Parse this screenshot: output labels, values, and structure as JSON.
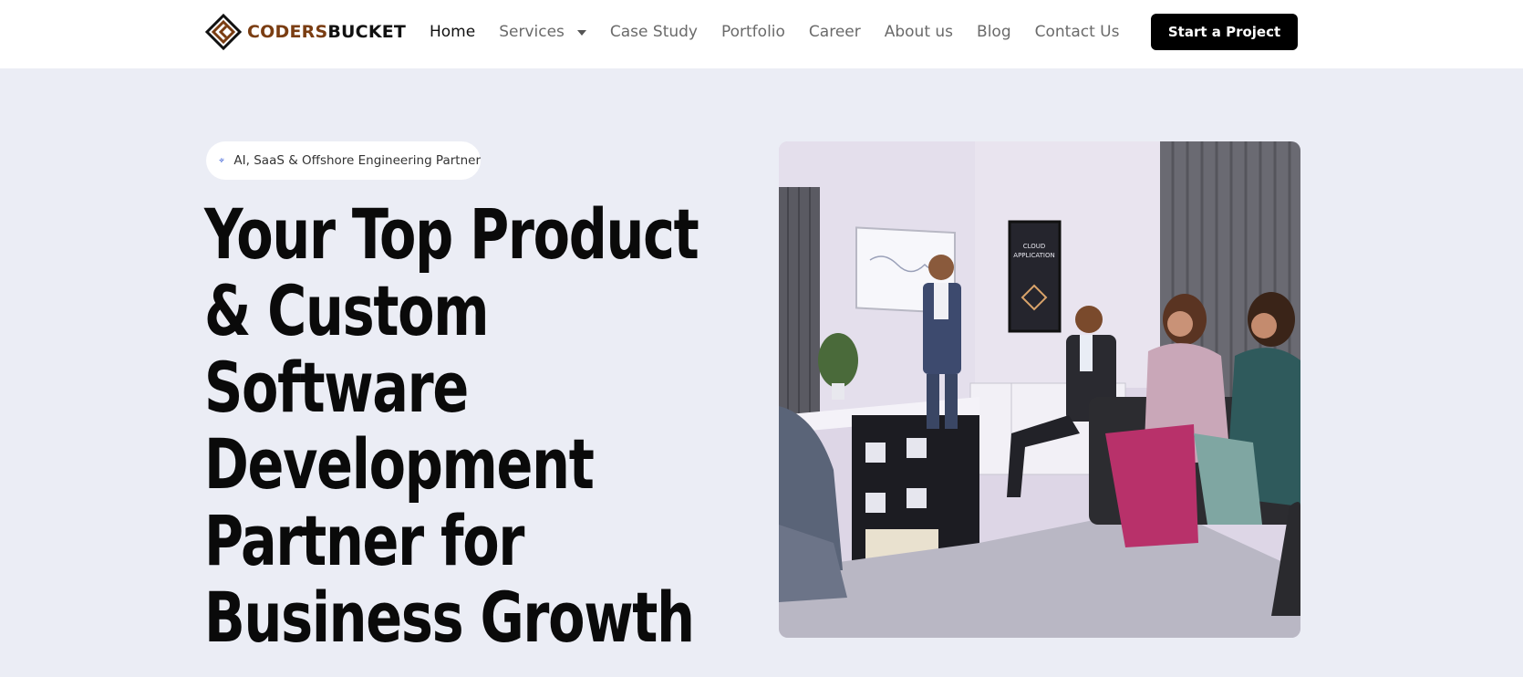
{
  "brand": {
    "name_part1": "CODERS",
    "name_part2": "BUCKET"
  },
  "nav": {
    "items": [
      {
        "label": "Home",
        "active": true
      },
      {
        "label": "Services",
        "has_dropdown": true
      },
      {
        "label": "Case Study"
      },
      {
        "label": "Portfolio"
      },
      {
        "label": "Career"
      },
      {
        "label": "About us"
      },
      {
        "label": "Blog"
      },
      {
        "label": "Contact Us"
      }
    ],
    "cta_label": "Start a Project"
  },
  "hero": {
    "badge_text": "AI, SaaS & Offshore Engineering Partner",
    "badge_icon": "sparkle-icon",
    "headline_lines": [
      "Your Top Product",
      "& Custom",
      "Software",
      "Development",
      "Partner for",
      "Business Growth"
    ],
    "image_text": [
      "CLOUD",
      "APPLICATION"
    ]
  },
  "colors": {
    "background": "#ebedf5",
    "brand_brown": "#7a3d12",
    "cta_bg": "#000000",
    "sparkle_blue": "#2f55d4"
  }
}
